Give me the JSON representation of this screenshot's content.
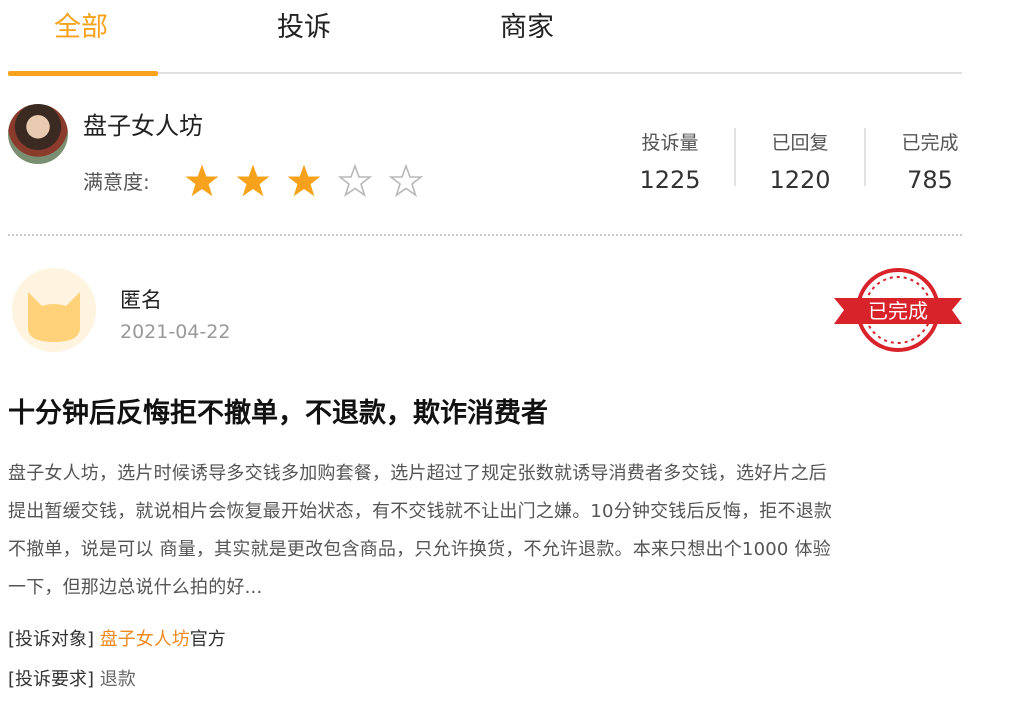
{
  "tabs": [
    {
      "label": "全部",
      "active": true
    },
    {
      "label": "投诉",
      "active": false
    },
    {
      "label": "商家",
      "active": false
    }
  ],
  "merchant": {
    "name": "盘子女人坊",
    "satisfaction_label": "满意度:",
    "rating": 3,
    "rating_max": 5,
    "stats": [
      {
        "label": "投诉量",
        "value": "1225"
      },
      {
        "label": "已回复",
        "value": "1220"
      },
      {
        "label": "已完成",
        "value": "785"
      }
    ]
  },
  "complaint": {
    "user": "匿名",
    "date": "2021-04-22",
    "status_stamp": "已完成",
    "title": "十分钟后反悔拒不撤单，不退款，欺诈消费者",
    "body_lines": [
      "盘子女人坊，选片时候诱导多交钱多加购套餐，选片超过了规定张数就诱导消费者多交钱，选好片之后",
      "提出暂缓交钱，就说相片会恢复最开始状态，有不交钱就不让出门之嫌。10分钟交钱后反悔，拒不退款",
      "不撤单，说是可以 商量，其实就是更改包含商品，只允许换货，不允许退款。本来只想出个1000 体验",
      "一下，但那边总说什么拍的好..."
    ],
    "target_label": "[投诉对象]",
    "target_link": "盘子女人坊",
    "target_suffix": "官方",
    "request_label": "[投诉要求]",
    "request_value": "退款"
  },
  "colors": {
    "accent": "#f7a21d",
    "link": "#f08a1e",
    "stamp_red": "#d9232a"
  }
}
